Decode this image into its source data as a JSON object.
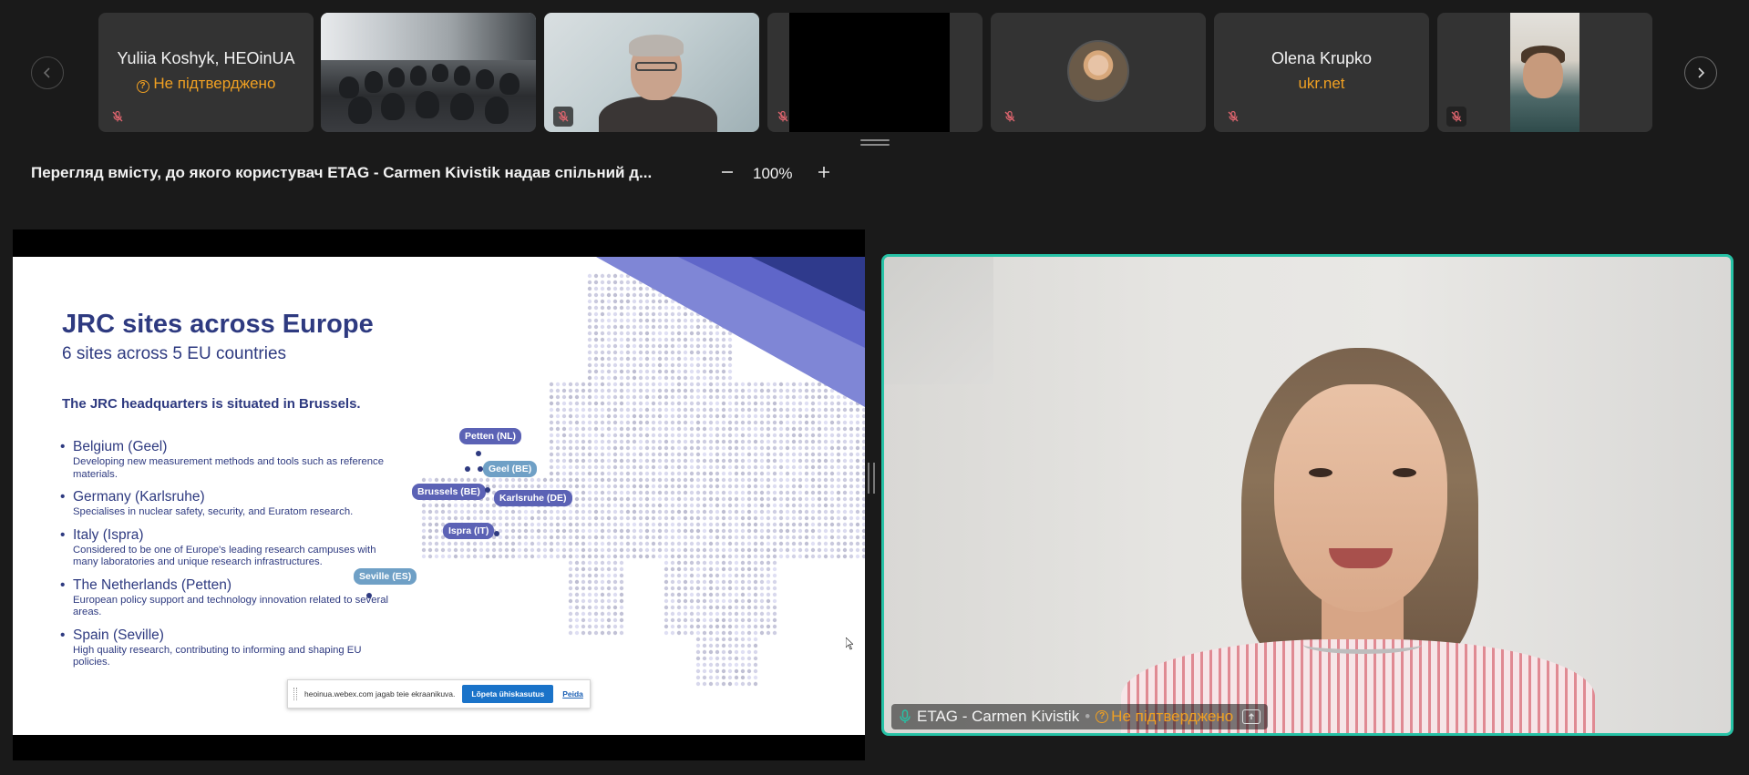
{
  "participants": [
    {
      "name": "Yuliia Koshyk, HEOinUA",
      "status": "Не підтверджено"
    },
    {
      "name": "",
      "status": ""
    },
    {
      "name": "",
      "status": ""
    },
    {
      "name": "",
      "status": ""
    },
    {
      "name": "",
      "status": ""
    },
    {
      "name": "Olena Krupko",
      "status": "ukr.net"
    },
    {
      "name": "",
      "status": ""
    }
  ],
  "share": {
    "title": "Перегляд вмісту, до якого користувач ETAG - Carmen Kivistik надав спільний д...",
    "zoom": "100%"
  },
  "slide": {
    "title": "JRC sites across Europe",
    "subtitle": "6 sites across 5 EU countries",
    "hq": "The JRC headquarters is situated in Brussels.",
    "sites": [
      {
        "name": "Belgium (Geel)",
        "desc": "Developing new measurement methods and tools such as reference materials."
      },
      {
        "name": "Germany (Karlsruhe)",
        "desc": "Specialises in nuclear safety, security, and Euratom research."
      },
      {
        "name": "Italy (Ispra)",
        "desc": "Considered to be one of Europe's leading research campuses with many laboratories and unique research infrastructures."
      },
      {
        "name": "The Netherlands (Petten)",
        "desc": "European policy support and technology innovation related to several areas."
      },
      {
        "name": "Spain (Seville)",
        "desc": "High quality research, contributing to informing and shaping EU policies."
      }
    ],
    "map_labels": {
      "petten": "Petten (NL)",
      "geel": "Geel (BE)",
      "brussels": "Brussels (BE)",
      "karlsruhe": "Karlsruhe (DE)",
      "ispra": "Ispra (IT)",
      "seville": "Seville (ES)"
    },
    "banner": {
      "message": "heoinua.webex.com jagab teie ekraanikuva.",
      "stop": "Lõpeta ühiskasutus",
      "hide": "Peida"
    }
  },
  "main_video": {
    "name": "ETAG - Carmen Kivistik",
    "status": "Не підтверджено"
  },
  "colors": {
    "accent_border": "#27c2a6",
    "warning": "#f0a022",
    "slide_navy": "#2e3a80"
  }
}
